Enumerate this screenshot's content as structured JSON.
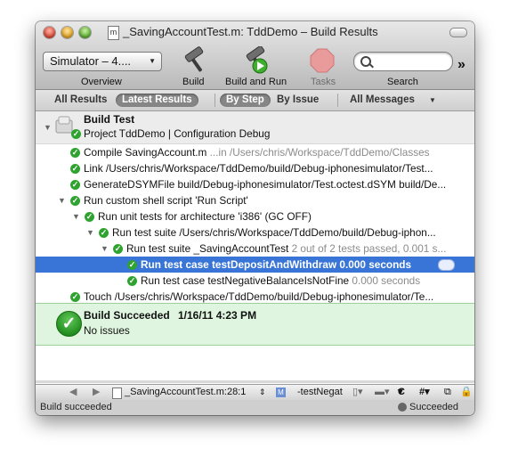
{
  "window": {
    "title": "_SavingAccountTest.m: TddDemo – Build Results",
    "doc_icon": "m"
  },
  "toolbar": {
    "scheme_value": "Simulator – 4....",
    "overview_label": "Overview",
    "build_label": "Build",
    "build_and_run_label": "Build and Run",
    "tasks_label": "Tasks",
    "search_label": "Search",
    "search_placeholder": "",
    "overflow_glyph": "»"
  },
  "scope": {
    "all_results": "All Results",
    "latest_results": "Latest Results",
    "by_step": "By Step",
    "by_issue": "By Issue",
    "all_messages": "All Messages"
  },
  "build": {
    "header_title": "Build Test",
    "header_subtitle": "Project TddDemo | Configuration Debug",
    "rows": [
      {
        "text": "Compile SavingAccount.m",
        "gray": " ...in /Users/chris/Workspace/TddDemo/Classes"
      },
      {
        "text": "Link /Users/chris/Workspace/TddDemo/build/Debug-iphonesimulator/Test...",
        "gray": ""
      },
      {
        "text": "GenerateDSYMFile build/Debug-iphonesimulator/Test.octest.dSYM build/De...",
        "gray": ""
      },
      {
        "text": "Run custom shell script 'Run Script'",
        "gray": ""
      },
      {
        "text": "Run unit tests for architecture 'i386' (GC OFF)",
        "gray": ""
      },
      {
        "text": "Run test suite /Users/chris/Workspace/TddDemo/build/Debug-iphon...",
        "gray": ""
      },
      {
        "text": "Run test suite _SavingAccountTest",
        "gray": " 2 out of 2 tests passed, 0.001 s..."
      },
      {
        "text": "Run test case testDepositAndWithdraw",
        "gray": " 0.000 seconds"
      },
      {
        "text": "Run test case testNegativeBalanceIsNotFine",
        "gray": " 0.000 seconds"
      },
      {
        "text": "Touch /Users/chris/Workspace/TddDemo/build/Debug-iphonesimulator/Te...",
        "gray": ""
      }
    ],
    "result_title": "Build Succeeded",
    "result_date": "1/16/11 4:23 PM",
    "result_issues": "No issues"
  },
  "navbar": {
    "file": "_SavingAccountTest.m:28:1",
    "method_badge": "M",
    "method": "-testNegat",
    "lang": "C"
  },
  "status": {
    "left": "Build succeeded",
    "right": "Succeeded"
  },
  "colors": {
    "accent": "#3875d7",
    "success": "#2fa32f",
    "success_bg": "#dff5df"
  }
}
